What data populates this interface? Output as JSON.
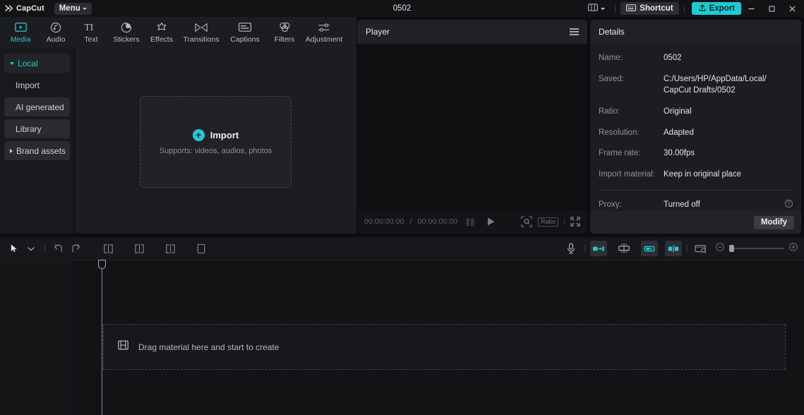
{
  "titlebar": {
    "app_name": "CapCut",
    "menu_label": "Menu",
    "project_title": "0502",
    "layout_icon": "layout-icon",
    "shortcut_label": "Shortcut",
    "shortcut_icon": "keyboard-icon",
    "export_label": "Export",
    "export_icon": "upload-icon",
    "export_color": "#1ecbd4",
    "minimize_label": "—",
    "maximize_label": "❐",
    "close_label": "✕"
  },
  "tabs": [
    {
      "label": "Media",
      "icon": "media-play-icon",
      "active": true
    },
    {
      "label": "Audio",
      "icon": "audio-note-icon",
      "active": false
    },
    {
      "label": "Text",
      "icon": "text-ti-icon",
      "active": false
    },
    {
      "label": "Stickers",
      "icon": "sticker-icon",
      "active": false
    },
    {
      "label": "Effects",
      "icon": "effects-star-icon",
      "active": false
    },
    {
      "label": "Transitions",
      "icon": "transitions-icon",
      "active": false
    },
    {
      "label": "Captions",
      "icon": "captions-icon",
      "active": false
    },
    {
      "label": "Filters",
      "icon": "filters-icon",
      "active": false
    },
    {
      "label": "Adjustment",
      "icon": "adjustment-icon",
      "active": false
    }
  ],
  "sidebar": {
    "items": [
      {
        "label": "Local",
        "chevron": "down",
        "chip": true,
        "accent": true
      },
      {
        "label": "Import",
        "chevron": "none",
        "chip": false,
        "accent": false
      },
      {
        "label": "AI generated",
        "chevron": "none",
        "chip": true,
        "accent": false
      },
      {
        "label": "Library",
        "chevron": "none",
        "chip": true,
        "accent": false
      },
      {
        "label": "Brand assets",
        "chevron": "right",
        "chip": true,
        "accent": false
      }
    ]
  },
  "media": {
    "dropzone_label": "Import",
    "dropzone_sub": "Supports: videos, audios, photos",
    "plus_glyph": "+"
  },
  "player": {
    "title": "Player",
    "menu_icon": "hamburger-icon",
    "current_time": "00:00:00:00",
    "separator": "/",
    "total_time": "00:00:00:00",
    "ratio_label": "Ratio",
    "play_icon": "play-icon",
    "frames_icon": "frames-icon",
    "zoom_icon": "magnifier-icon",
    "fullscreen_icon": "fullscreen-icon"
  },
  "details": {
    "title": "Details",
    "rows": [
      {
        "key": "Name:",
        "value": "0502"
      },
      {
        "key": "Saved:",
        "value": "C:/Users/HP/AppData/Local/ CapCut Drafts/0502"
      },
      {
        "key": "Ratio:",
        "value": "Original"
      },
      {
        "key": "Resolution:",
        "value": "Adapted"
      },
      {
        "key": "Frame rate:",
        "value": "30.00fps"
      },
      {
        "key": "Import material:",
        "value": "Keep in original place"
      }
    ],
    "proxy": {
      "key": "Proxy:",
      "value": "Turned off",
      "help_glyph": "?"
    },
    "modify_label": "Modify"
  },
  "timeline_toolbar": {
    "cursor_icon": "cursor-arrow-icon",
    "cursor_caret": "chevron-down-icon",
    "undo_icon": "undo-icon",
    "redo_icon": "redo-icon",
    "split_icon": "split-icon",
    "trim_left_icon": "trim-left-icon",
    "trim_right_icon": "trim-right-icon",
    "delete_icon": "delete-icon",
    "mic_icon": "microphone-icon",
    "auto_cut_icon": "auto-cut-icon",
    "magnet_icon": "magnet-snap-icon",
    "link_icon": "link-clip-icon",
    "mirror_icon": "mirror-icon",
    "preview_icon": "preview-card-icon",
    "zoom_out_icon": "zoom-out-icon",
    "zoom_in_icon": "zoom-in-icon",
    "zoom_value": 8
  },
  "timeline": {
    "drop_label": "Drag material here and start to create",
    "drop_icon": "film-strip-icon",
    "playhead_position": "00:00:00:00"
  }
}
